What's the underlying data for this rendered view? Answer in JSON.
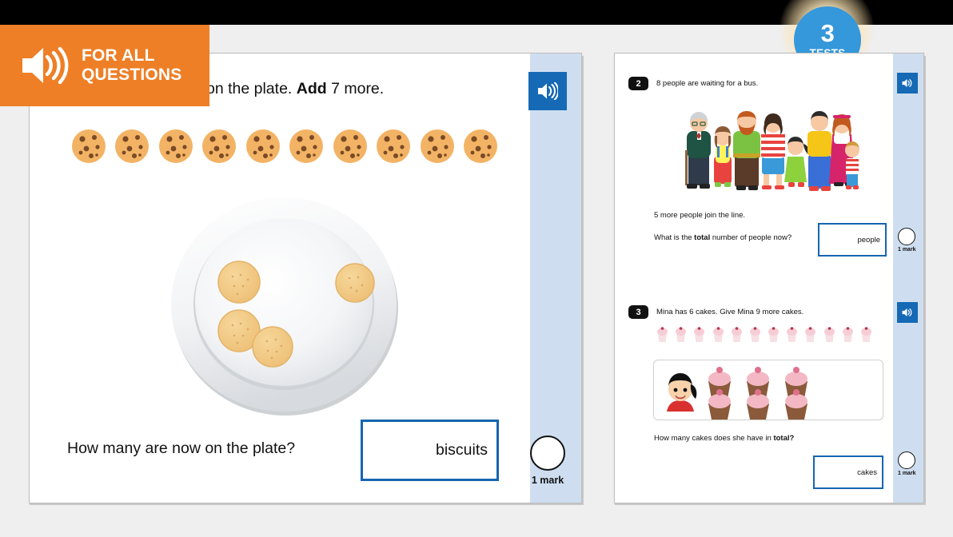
{
  "badge": {
    "number": "3",
    "label": "TESTS",
    "color": "#3498db"
  },
  "banner": {
    "line1": "FOR ALL",
    "line2": "QUESTIONS",
    "icon": "speaker-icon",
    "color": "#ee7f26"
  },
  "left_page": {
    "question_text_visible": "on the plate. ",
    "question_text_bold": "Add",
    "question_text_tail": " 7 more.",
    "cookie_count": 10,
    "plate_biscuit_count": 4,
    "ask": "How many are now on the plate?",
    "answer_unit": "biscuits",
    "mark_label": "1 mark",
    "audio_icon": "speaker-icon"
  },
  "right_page": {
    "questions": [
      {
        "number": "2",
        "heading": "8 people are waiting for a bus.",
        "image": "family-group-8-people",
        "line1": "5 more people join the line.",
        "line2_pre": "What is the ",
        "line2_bold": "total",
        "line2_post": " number of people now?",
        "answer_unit": "people",
        "mark_label": "1 mark",
        "audio_icon": "speaker-icon"
      },
      {
        "number": "3",
        "heading": "Mina has 6 cakes. Give Mina 9 more cakes.",
        "strip_cake_count": 12,
        "box_cake_count": 6,
        "box_avatar": "girl-avatar",
        "ask_pre": "How many cakes does she have in ",
        "ask_bold": "total?",
        "answer_unit": "cakes",
        "mark_label": "1 mark",
        "audio_icon": "speaker-icon"
      }
    ]
  },
  "colors": {
    "accent_blue": "#1565b0",
    "marks_strip": "#cedef0",
    "orange": "#ee7f26",
    "page_bg": "#efefef"
  }
}
